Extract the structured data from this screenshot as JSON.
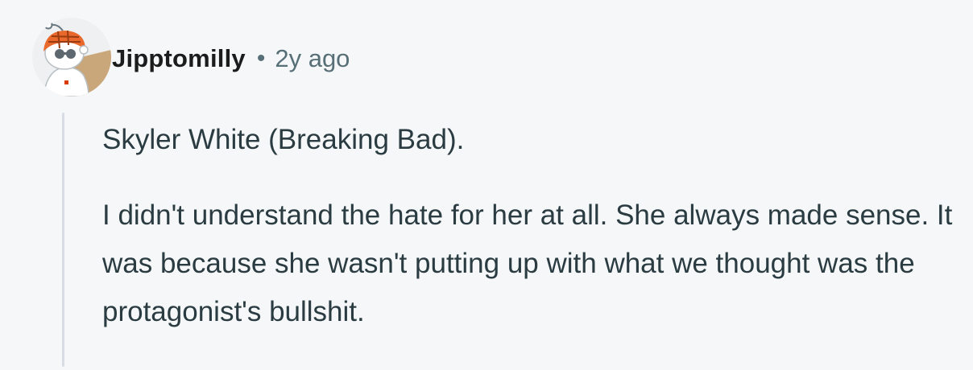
{
  "comment": {
    "author": "Jipptomilly",
    "separator": "•",
    "timestamp": "2y ago",
    "avatar_icon": "snoo-avatar-icon",
    "paragraphs": [
      "Skyler White (Breaking Bad).",
      "I didn't understand the hate for her at all. She always made sense. It was because she wasn't putting up with what we thought was the protagonist's bullshit."
    ]
  },
  "colors": {
    "background": "#f6f7f8",
    "author": "#1c1c1c",
    "meta": "#576f76",
    "body_text": "#2a3c42",
    "thread_line": "#d8dde3"
  }
}
